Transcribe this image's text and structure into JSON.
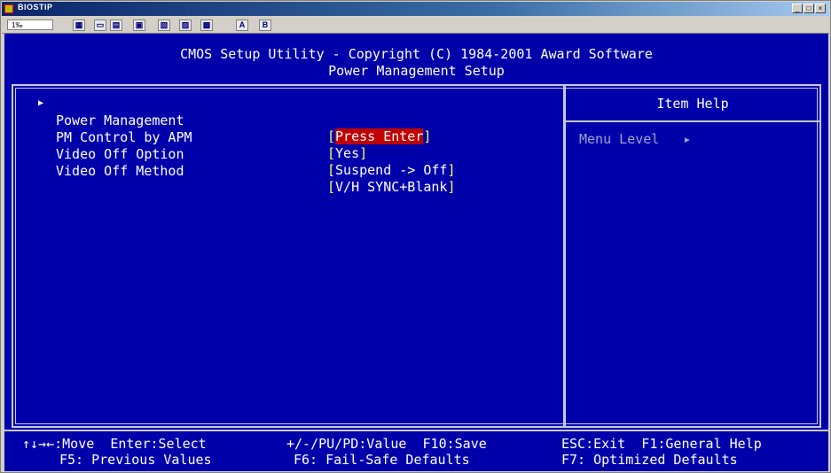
{
  "window": {
    "title": "BIOSTIP",
    "controls": [
      "_",
      "□",
      "×"
    ]
  },
  "toolbar": {
    "dropdown_value": "1‰",
    "buttons": [
      "A",
      "B"
    ]
  },
  "header": {
    "line1": "CMOS Setup Utility - Copyright (C) 1984-2001 Award Software",
    "line2": "Power Management Setup"
  },
  "settings": [
    {
      "label": "Power Management",
      "value": "Press Enter",
      "selected": true,
      "submenu": true
    },
    {
      "label": "PM Control by APM",
      "value": "Yes"
    },
    {
      "label": "Video Off Option",
      "value": "Suspend -> Off"
    },
    {
      "label": "Video Off Method",
      "value": "V/H SYNC+Blank"
    }
  ],
  "help": {
    "title": "Item Help",
    "menu_level": "Menu Level   ▸"
  },
  "footer": {
    "row1": [
      "↑↓→←:Move  Enter:Select",
      "+/-/PU/PD:Value  F10:Save",
      "ESC:Exit  F1:General Help"
    ],
    "row2": [
      "F5: Previous Values",
      "F6: Fail-Safe Defaults",
      "F7: Optimized Defaults"
    ]
  },
  "colors": {
    "screen_bg": "#0000aa",
    "selection_bg": "#c00000",
    "bracket": "#ffff55",
    "help_dim": "#9da4c8"
  }
}
